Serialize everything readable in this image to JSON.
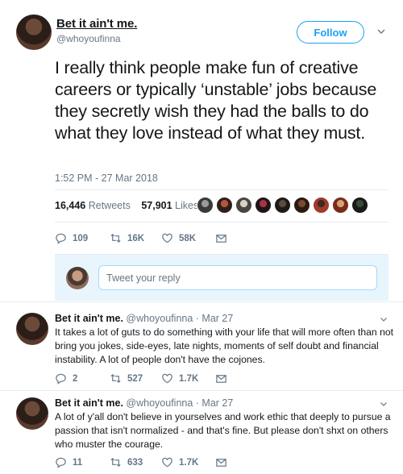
{
  "tweet": {
    "display_name": "Bet it ain't me.",
    "handle": "@whoyoufinna",
    "follow_label": "Follow",
    "text": "I really think people make fun of creative careers or typically ‘unstable’ jobs because they secretly wish they had the balls to do what they love instead of what they must.",
    "timestamp": "1:52 PM - 27 Mar 2018",
    "retweets_count": "16,446",
    "retweets_label": "Retweets",
    "likes_count": "57,901",
    "likes_label": "Likes",
    "actions": {
      "replies": "109",
      "retweets": "16K",
      "likes": "58K"
    }
  },
  "reply_box": {
    "placeholder": "Tweet your reply"
  },
  "replies": [
    {
      "display_name": "Bet it ain't me.",
      "handle": "@whoyoufinna",
      "date": "· Mar 27",
      "text": "It takes a lot of guts to do something with your life that will more often than not bring you jokes, side-eyes, late nights, moments of self doubt and financial instability. A lot of people don't have the cojones.",
      "replies": "2",
      "retweets": "527",
      "likes": "1.7K"
    },
    {
      "display_name": "Bet it ain't me.",
      "handle": "@whoyoufinna",
      "date": "· Mar 27",
      "text": "A lot of y'all don't believe in yourselves and work ethic that deeply to pursue a passion that isn't normalized - and that's fine. But please don't shxt on others who muster the courage.",
      "replies": "11",
      "retweets": "633",
      "likes": "1.7K"
    }
  ],
  "colors": {
    "accent": "#1da1f2",
    "muted": "#657786",
    "text": "#14171a",
    "border": "#e6ecf0"
  },
  "icons": [
    "reply-icon",
    "retweet-icon",
    "like-icon",
    "message-icon",
    "chevron-down-icon"
  ]
}
